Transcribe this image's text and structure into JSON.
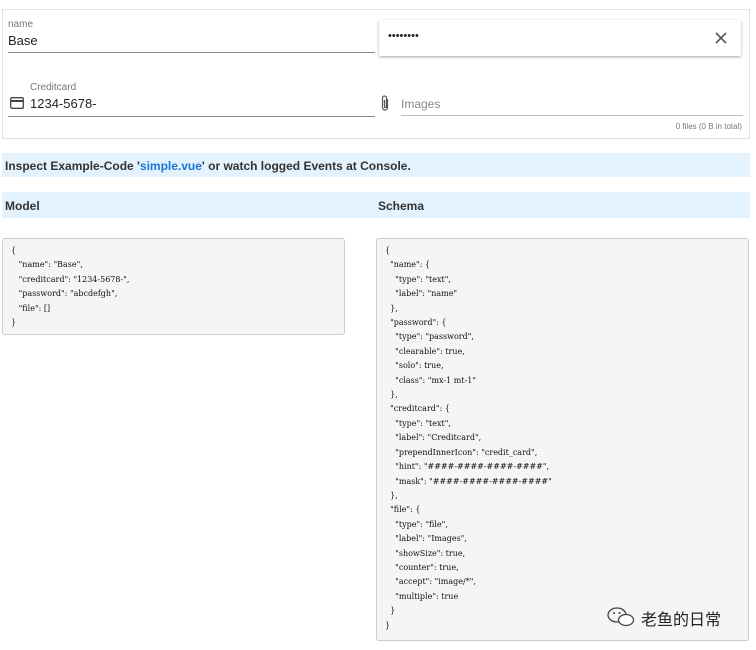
{
  "form": {
    "name": {
      "label": "name",
      "value": "Base"
    },
    "password": {
      "value": "••••••••",
      "clear_icon": "close-icon"
    },
    "creditcard": {
      "label": "Creditcard",
      "value": "1234-5678-",
      "prepend_icon": "credit-card-icon"
    },
    "file": {
      "placeholder": "Images",
      "prepend_icon": "paperclip-icon",
      "counter": "0 files (0 B in total)"
    }
  },
  "info": {
    "prefix": "Inspect Example-Code '",
    "link": "simple.vue",
    "suffix": "' or watch logged Events at Console."
  },
  "headers": {
    "model": "Model",
    "schema": "Schema"
  },
  "model_code": "{\n   \"name\": \"Base\",\n   \"creditcard\": \"1234-5678-\",\n   \"password\": \"abcdefgh\",\n   \"file\": []\n}",
  "schema_code": "{\n  \"name\": {\n    \"type\": \"text\",\n    \"label\": \"name\"\n  },\n  \"password\": {\n    \"type\": \"password\",\n    \"clearable\": true,\n    \"solo\": true,\n    \"class\": \"mx-1 mt-1\"\n  },\n  \"creditcard\": {\n    \"type\": \"text\",\n    \"label\": \"Creditcard\",\n    \"prependInnerIcon\": \"credit_card\",\n    \"hint\": \"####-####-####-####\",\n    \"mask\": \"####-####-####-####\"\n  },\n  \"file\": {\n    \"type\": \"file\",\n    \"label\": \"Images\",\n    \"showSize\": true,\n    \"counter\": true,\n    \"accept\": \"image/*\",\n    \"multiple\": true\n  }\n}",
  "watermark": {
    "text": "老鱼的日常",
    "icon": "wechat-icon"
  }
}
